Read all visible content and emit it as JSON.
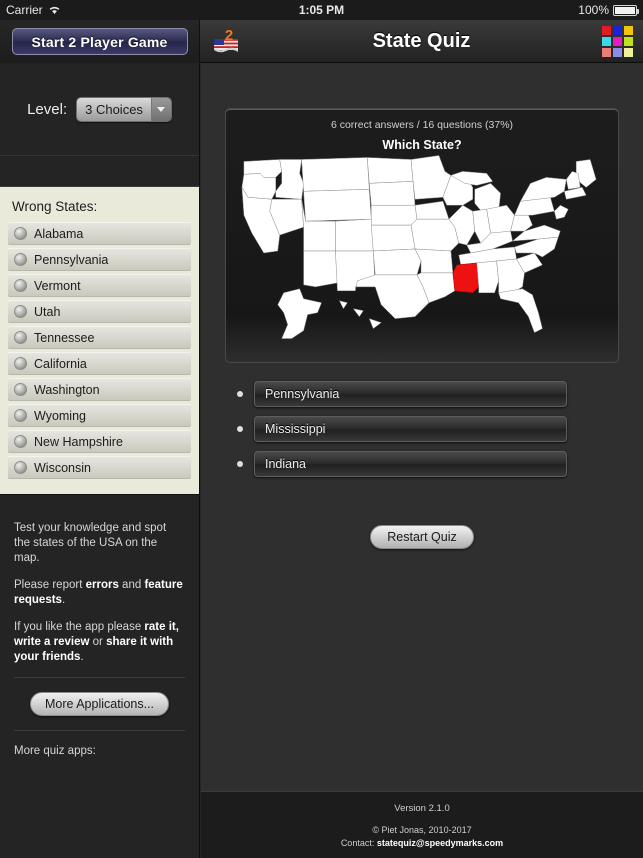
{
  "status_bar": {
    "carrier": "Carrier",
    "wifi_icon": "wifi-icon",
    "time": "1:05 PM",
    "battery_percent": "100%",
    "battery_icon": "battery-full-icon"
  },
  "nav": {
    "two_player_button": "Start 2 Player Game",
    "flag_icon": "usa-flag-two-player-icon",
    "title": "State Quiz",
    "grid_icon": "color-grid-apps-icon",
    "grid_colors": [
      "#e01b24",
      "#1b23d8",
      "#f2c40b",
      "#3fd7e8",
      "#ea18c0",
      "#bfe21c",
      "#f07c78",
      "#8a8ce8",
      "#f0ef9a"
    ]
  },
  "sidebar": {
    "level_label": "Level:",
    "level_value": "3 Choices",
    "level_options": [
      "3 Choices"
    ],
    "wrong_states_title": "Wrong States:",
    "wrong_states": [
      "Alabama",
      "Pennsylvania",
      "Vermont",
      "Utah",
      "Tennessee",
      "California",
      "Washington",
      "Wyoming",
      "New Hampshire",
      "Wisconsin"
    ],
    "info_p1": "Test your knowledge and spot the states of the USA on the map.",
    "info_p2_a": "Please report ",
    "info_p2_b": "errors",
    "info_p2_c": " and ",
    "info_p2_d": "feature requests",
    "info_p2_e": ".",
    "info_p3_a": "If you like the app please ",
    "info_p3_b": "rate it, write a review",
    "info_p3_c": " or ",
    "info_p3_d": "share it with your friends",
    "info_p3_e": ".",
    "more_applications_button": "More Applications...",
    "more_quiz_apps_label": "More quiz apps:"
  },
  "main": {
    "score_text": "6 correct answers / 16 questions (37%)",
    "question_text": "Which State?",
    "highlighted_state": "Mississippi",
    "highlight_color": "#ee1111",
    "map_land_color": "#ffffff",
    "map_background": "#161616",
    "answers": [
      "Pennsylvania",
      "Mississippi",
      "Indiana"
    ],
    "restart_button": "Restart Quiz"
  },
  "footer": {
    "version": "Version 2.1.0",
    "copyright": "© Piet Jonas, 2010-2017",
    "contact_label": "Contact: ",
    "contact_email": "statequiz@speedymarks.com"
  }
}
